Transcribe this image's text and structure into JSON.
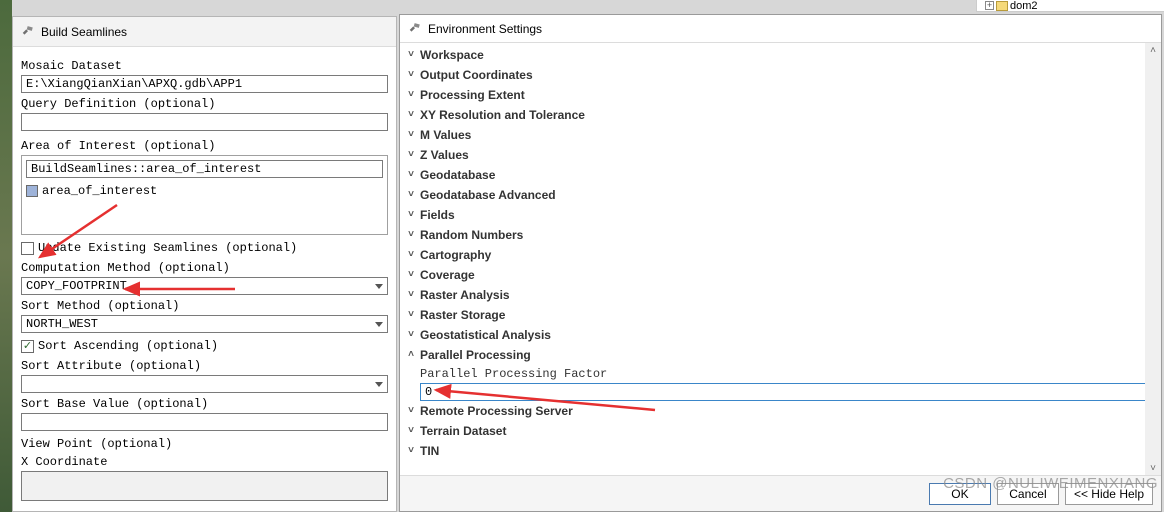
{
  "left_panel": {
    "title": "Build Seamlines",
    "mosaic_label": "Mosaic Dataset",
    "mosaic_value": "E:\\XiangQianXian\\APXQ.gdb\\APP1",
    "query_label": "Query Definition (optional)",
    "query_value": "",
    "aoi_label": "Area of Interest (optional)",
    "aoi_row1": "BuildSeamlines::area_of_interest",
    "aoi_row2": "area_of_interest",
    "update_chk_label": "Update Existing Seamlines (optional)",
    "update_checked": false,
    "comp_label": "Computation Method (optional)",
    "comp_value": "COPY_FOOTPRINT",
    "sort_method_label": "Sort Method (optional)",
    "sort_method_value": "NORTH_WEST",
    "sort_asc_label": "Sort Ascending (optional)",
    "sort_asc_checked": true,
    "sort_attr_label": "Sort Attribute (optional)",
    "sort_attr_value": "",
    "sort_base_label": "Sort Base Value (optional)",
    "sort_base_value": "",
    "viewpoint_label": "View Point (optional)",
    "xcoord_label": "X Coordinate"
  },
  "env_panel": {
    "title": "Environment Settings",
    "items": [
      {
        "label": "Workspace",
        "expanded": false
      },
      {
        "label": "Output Coordinates",
        "expanded": false
      },
      {
        "label": "Processing Extent",
        "expanded": false
      },
      {
        "label": "XY Resolution and Tolerance",
        "expanded": false
      },
      {
        "label": "M Values",
        "expanded": false
      },
      {
        "label": "Z Values",
        "expanded": false
      },
      {
        "label": "Geodatabase",
        "expanded": false
      },
      {
        "label": "Geodatabase Advanced",
        "expanded": false
      },
      {
        "label": "Fields",
        "expanded": false
      },
      {
        "label": "Random Numbers",
        "expanded": false
      },
      {
        "label": "Cartography",
        "expanded": false
      },
      {
        "label": "Coverage",
        "expanded": false
      },
      {
        "label": "Raster Analysis",
        "expanded": false
      },
      {
        "label": "Raster Storage",
        "expanded": false
      },
      {
        "label": "Geostatistical Analysis",
        "expanded": false
      },
      {
        "label": "Parallel Processing",
        "expanded": true
      },
      {
        "label": "Remote Processing Server",
        "expanded": false
      },
      {
        "label": "Terrain Dataset",
        "expanded": false
      },
      {
        "label": "TIN",
        "expanded": false
      }
    ],
    "parallel": {
      "sub_label": "Parallel Processing Factor",
      "value": "0"
    },
    "buttons": {
      "ok": "OK",
      "cancel": "Cancel",
      "hide_help": "<< Hide Help"
    }
  },
  "toc": {
    "node1": "dom2"
  },
  "watermark": "CSDN @NULIWEIMENXIANG"
}
